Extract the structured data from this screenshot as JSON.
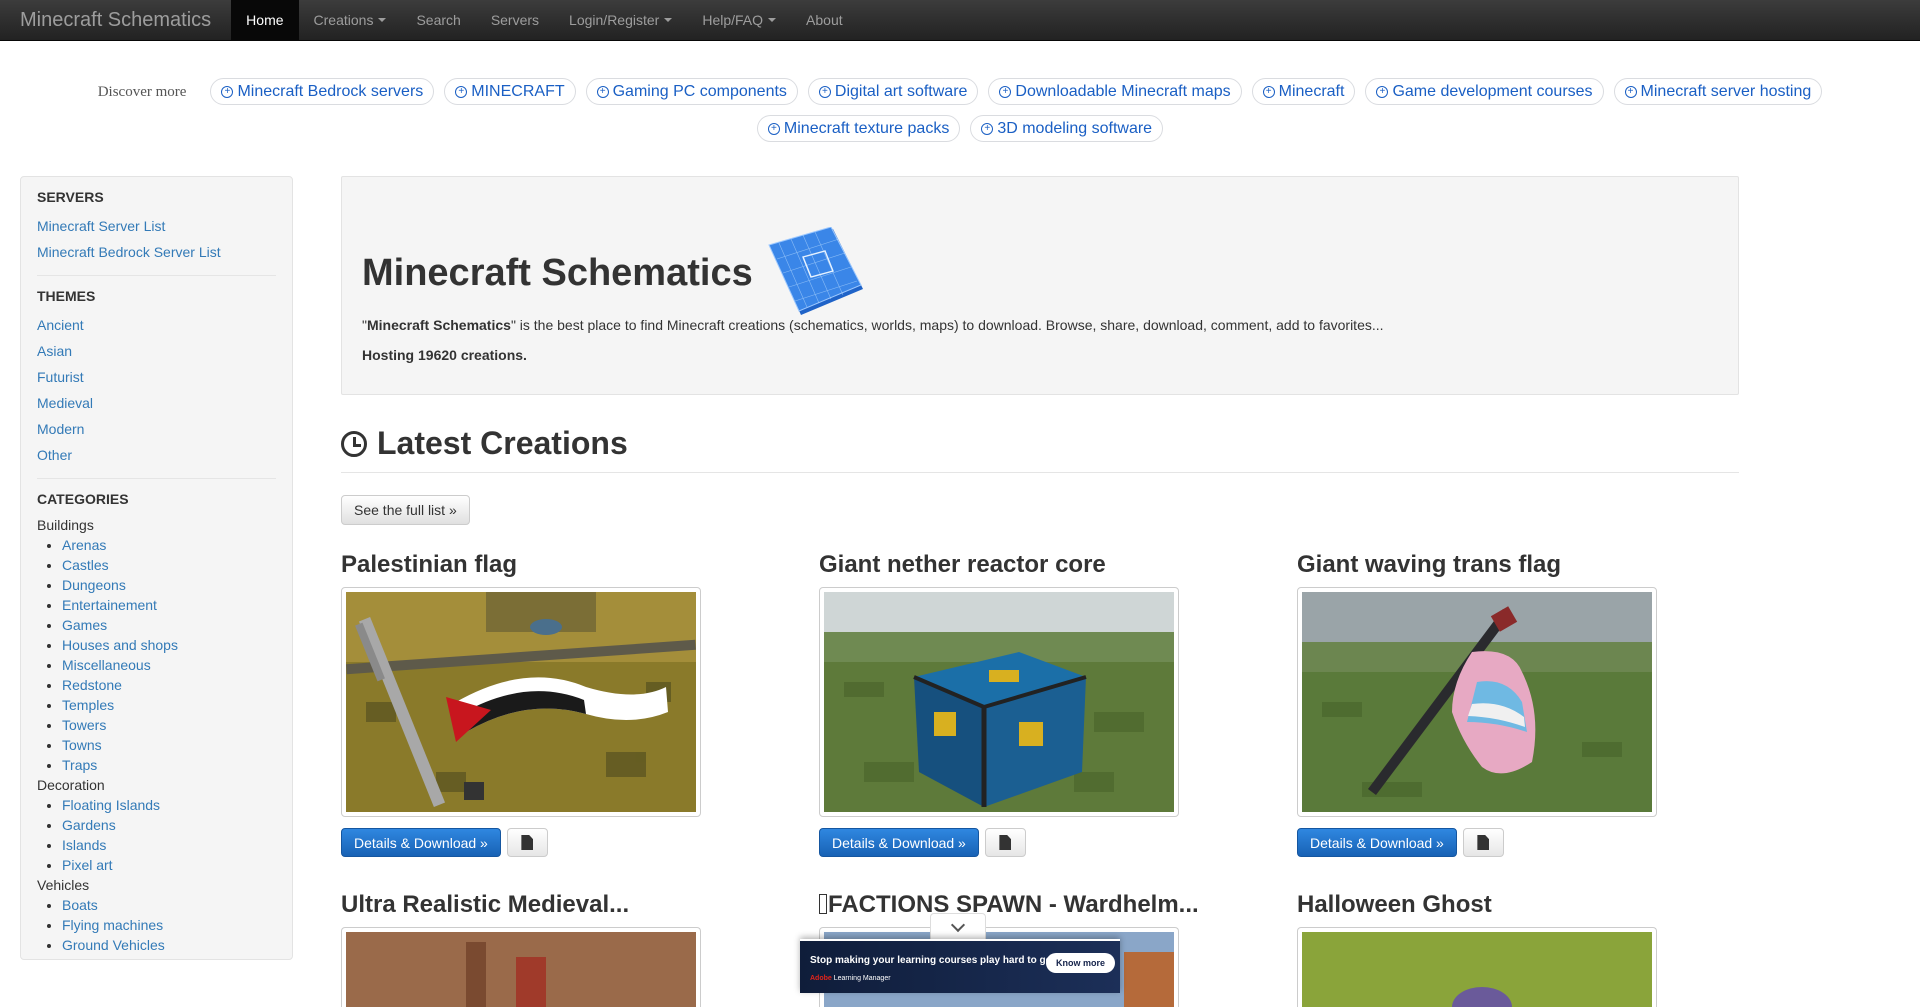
{
  "navbar": {
    "brand": "Minecraft Schematics",
    "items": [
      {
        "label": "Home"
      },
      {
        "label": "Creations"
      },
      {
        "label": "Search"
      },
      {
        "label": "Servers"
      },
      {
        "label": "Login/Register"
      },
      {
        "label": "Help/FAQ"
      },
      {
        "label": "About"
      }
    ]
  },
  "discover": {
    "label": "Discover more",
    "chips": [
      "Minecraft Bedrock servers",
      "MINECRAFT",
      "Gaming PC components",
      "Digital art software",
      "Downloadable Minecraft maps",
      "Minecraft",
      "Game development courses",
      "Minecraft server hosting",
      "Minecraft texture packs",
      "3D modeling software"
    ]
  },
  "sidebar": {
    "servers_heading": "SERVERS",
    "servers": [
      "Minecraft Server List",
      "Minecraft Bedrock Server List"
    ],
    "themes_heading": "THEMES",
    "themes": [
      "Ancient",
      "Asian",
      "Futurist",
      "Medieval",
      "Modern",
      "Other"
    ],
    "categories_heading": "CATEGORIES",
    "groups": [
      {
        "name": "Buildings",
        "items": [
          "Arenas",
          "Castles",
          "Dungeons",
          "Entertainement",
          "Games",
          "Houses and shops",
          "Miscellaneous",
          "Redstone",
          "Temples",
          "Towers",
          "Towns",
          "Traps"
        ]
      },
      {
        "name": "Decoration",
        "items": [
          "Floating Islands",
          "Gardens",
          "Islands",
          "Pixel art"
        ]
      },
      {
        "name": "Vehicles",
        "items": [
          "Boats",
          "Flying machines",
          "Ground Vehicles"
        ]
      }
    ]
  },
  "jumbotron": {
    "title": "Minecraft Schematics",
    "desc_quote_open": "\"",
    "desc_bold": "Minecraft Schematics",
    "desc_rest": "\" is the best place to find Minecraft creations (schematics, worlds, maps) to download. Browse, share, download, comment, add to favorites...",
    "hosting": "Hosting 19620 creations."
  },
  "latest": {
    "heading": "Latest Creations",
    "full_list_button": "See the full list »",
    "details_button": "Details & Download »",
    "creations": [
      {
        "title": "Palestinian flag"
      },
      {
        "title": "Giant nether reactor core"
      },
      {
        "title": "Giant waving trans flag"
      },
      {
        "title": "Ultra Realistic Medieval..."
      },
      {
        "title": "FACTIONS SPAWN - Wardhelm..."
      },
      {
        "title": "Halloween Ghost"
      }
    ]
  },
  "ad": {
    "text": "Stop making your learning courses  play hard to get.",
    "brand_red": "Adobe",
    "brand_rest": " Learning Manager",
    "cta": "Know more"
  },
  "colors": {
    "link": "#337ab7",
    "chip_text": "#1a5fc4",
    "primary_button": "#1862b5",
    "navbar": "#222222"
  }
}
